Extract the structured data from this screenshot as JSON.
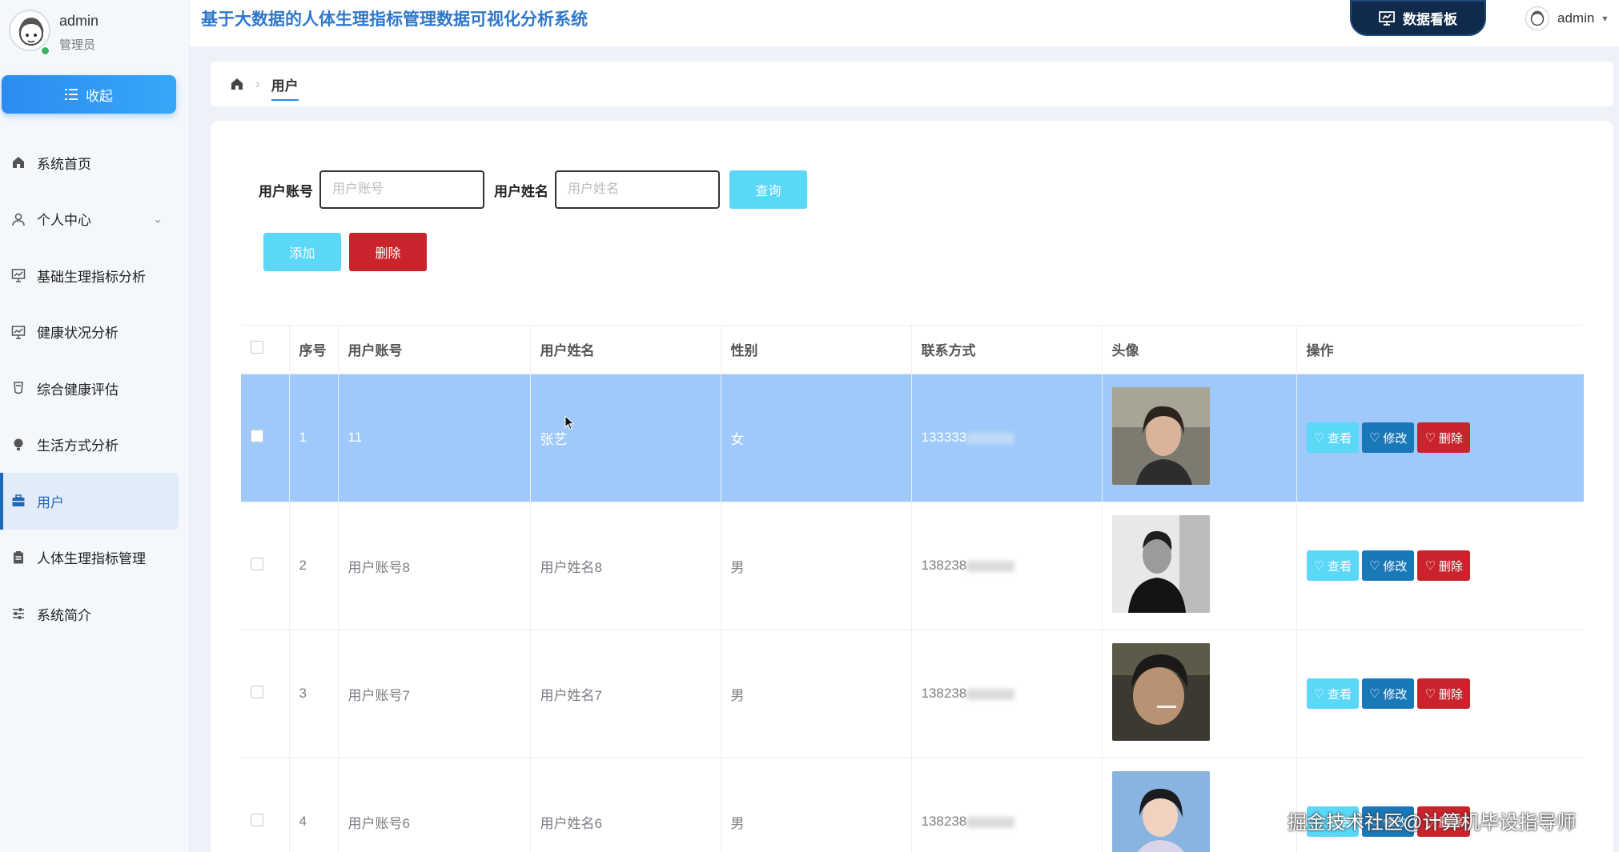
{
  "header": {
    "title": "基于大数据的人体生理指标管理数据可视化分析系统",
    "board_button": "数据看板",
    "user": "admin"
  },
  "sidebar": {
    "user": {
      "name": "admin",
      "role": "管理员"
    },
    "collapse_label": "收起",
    "items": [
      {
        "label": "系统首页",
        "icon": "home-icon"
      },
      {
        "label": "个人中心",
        "icon": "user-icon"
      },
      {
        "label": "基础生理指标分析",
        "icon": "chart-board-icon"
      },
      {
        "label": "健康状况分析",
        "icon": "chart-board-icon"
      },
      {
        "label": "综合健康评估",
        "icon": "cup-icon"
      },
      {
        "label": "生活方式分析",
        "icon": "bulb-icon"
      },
      {
        "label": "用户",
        "icon": "suitcase-icon"
      },
      {
        "label": "人体生理指标管理",
        "icon": "clipboard-icon"
      },
      {
        "label": "系统简介",
        "icon": "sliders-icon"
      }
    ],
    "active_index": 6
  },
  "breadcrumb": {
    "current": "用户"
  },
  "search": {
    "account_label": "用户账号",
    "account_placeholder": "用户账号",
    "name_label": "用户姓名",
    "name_placeholder": "用户姓名",
    "query_label": "查询"
  },
  "actions": {
    "add_label": "添加",
    "delete_label": "删除"
  },
  "table": {
    "headers": [
      "序号",
      "用户账号",
      "用户姓名",
      "性别",
      "联系方式",
      "头像",
      "操作"
    ],
    "rows": [
      {
        "index": "1",
        "account": "11",
        "name": "张艺",
        "gender": "女",
        "phone": "133333"
      },
      {
        "index": "2",
        "account": "用户账号8",
        "name": "用户姓名8",
        "gender": "男",
        "phone": "138238"
      },
      {
        "index": "3",
        "account": "用户账号7",
        "name": "用户姓名7",
        "gender": "男",
        "phone": "138238"
      },
      {
        "index": "4",
        "account": "用户账号6",
        "name": "用户姓名6",
        "gender": "男",
        "phone": "138238"
      }
    ],
    "op_view": "查看",
    "op_edit": "修改",
    "op_delete": "删除"
  },
  "colors": {
    "primary": "#2a8cf0",
    "cyan": "#5bd7f7",
    "danger": "#c9242b",
    "selected_row": "#9ec9fa"
  },
  "watermark": "掘金技术社区@计算机毕设指导师"
}
